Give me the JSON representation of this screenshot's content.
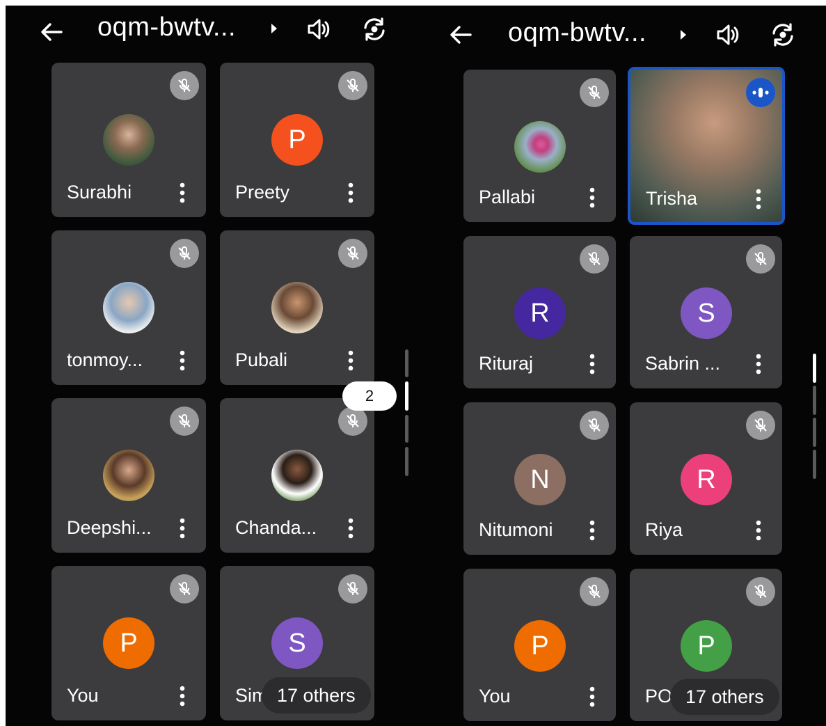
{
  "left_screen": {
    "title": "oqm-bwtv...",
    "page_indicator": "2",
    "others_label": "17 others",
    "tiles": [
      {
        "name": "Surabhi",
        "avatar_type": "photo",
        "initial": "",
        "color": ""
      },
      {
        "name": "Preety",
        "avatar_type": "letter",
        "initial": "P",
        "color": "#f4511e"
      },
      {
        "name": "tonmoy...",
        "avatar_type": "photo",
        "initial": "",
        "color": ""
      },
      {
        "name": "Pubali",
        "avatar_type": "photo",
        "initial": "",
        "color": ""
      },
      {
        "name": "Deepshi...",
        "avatar_type": "photo",
        "initial": "",
        "color": ""
      },
      {
        "name": "Chanda...",
        "avatar_type": "photo",
        "initial": "",
        "color": ""
      },
      {
        "name": "You",
        "avatar_type": "letter",
        "initial": "P",
        "color": "#ef6c00"
      },
      {
        "name": "Sim",
        "avatar_type": "letter",
        "initial": "S",
        "color": "#7e57c2"
      }
    ]
  },
  "right_screen": {
    "title": "oqm-bwtv...",
    "others_label": "17 others",
    "tiles": [
      {
        "name": "Pallabi",
        "avatar_type": "photo",
        "initial": "",
        "color": ""
      },
      {
        "name": "Trisha",
        "avatar_type": "video",
        "initial": "",
        "color": ""
      },
      {
        "name": "Rituraj",
        "avatar_type": "letter",
        "initial": "R",
        "color": "#4527a0"
      },
      {
        "name": "Sabrin ...",
        "avatar_type": "letter",
        "initial": "S",
        "color": "#7e57c2"
      },
      {
        "name": "Nitumoni",
        "avatar_type": "letter",
        "initial": "N",
        "color": "#8d6e63"
      },
      {
        "name": "Riya",
        "avatar_type": "letter",
        "initial": "R",
        "color": "#ec407a"
      },
      {
        "name": "You",
        "avatar_type": "letter",
        "initial": "P",
        "color": "#ef6c00"
      },
      {
        "name": "POR",
        "avatar_type": "letter",
        "initial": "P",
        "color": "#43a047"
      }
    ]
  },
  "icons": {
    "back": "arrow-back-icon",
    "title_caret": "caret-right-icon",
    "speaker": "speaker-icon",
    "switch_camera": "switch-camera-icon",
    "mic_off": "mic-off-icon",
    "speaking": "speaking-indicator-icon",
    "more": "more-vert-icon"
  }
}
